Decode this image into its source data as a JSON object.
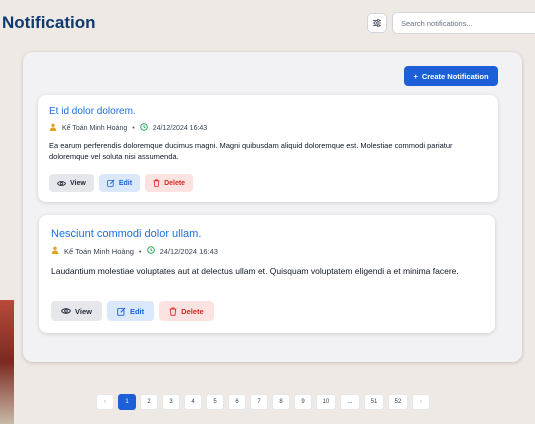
{
  "header": {
    "title": "Notification",
    "filter_icon": "sliders-icon",
    "search_placeholder": "Search notifications..."
  },
  "toolbar": {
    "create_label": "Create Notification",
    "create_icon": "+"
  },
  "notifications": [
    {
      "title": "Et id dolor dolorem.",
      "author": "Kế Toán Minh Hoàng",
      "separator": "•",
      "timestamp": "24/12/2024 16:43",
      "description": "Ea earum perferendis doloremque ducimus magni. Magni quibusdam aliquid doloremque est. Molestiae commodi pariatur doloremque vel soluta nisi assumenda.",
      "view_label": "View",
      "edit_label": "Edit",
      "delete_label": "Delete"
    },
    {
      "title": "Nesciunt commodi dolor ullam.",
      "author": "Kế Toán Minh Hoàng",
      "separator": "•",
      "timestamp": "24/12/2024 16:43",
      "description": "Laudantium molestiae voluptates aut at delectus ullam et. Quisquam voluptatem eligendi a et minima facere.",
      "view_label": "View",
      "edit_label": "Edit",
      "delete_label": "Delete"
    }
  ],
  "pagination": {
    "prev": "‹",
    "next": "›",
    "pages": [
      "1",
      "2",
      "3",
      "4",
      "5",
      "6",
      "7",
      "8",
      "9",
      "10",
      "...",
      "51",
      "52"
    ],
    "current": "1"
  },
  "colors": {
    "title": "#0f3a6e",
    "accent": "#1d5fd6",
    "card_title": "#1d6fe0",
    "delete": "#dc2626",
    "user_icon": "#e3a21a",
    "clock_icon": "#16a34a"
  }
}
